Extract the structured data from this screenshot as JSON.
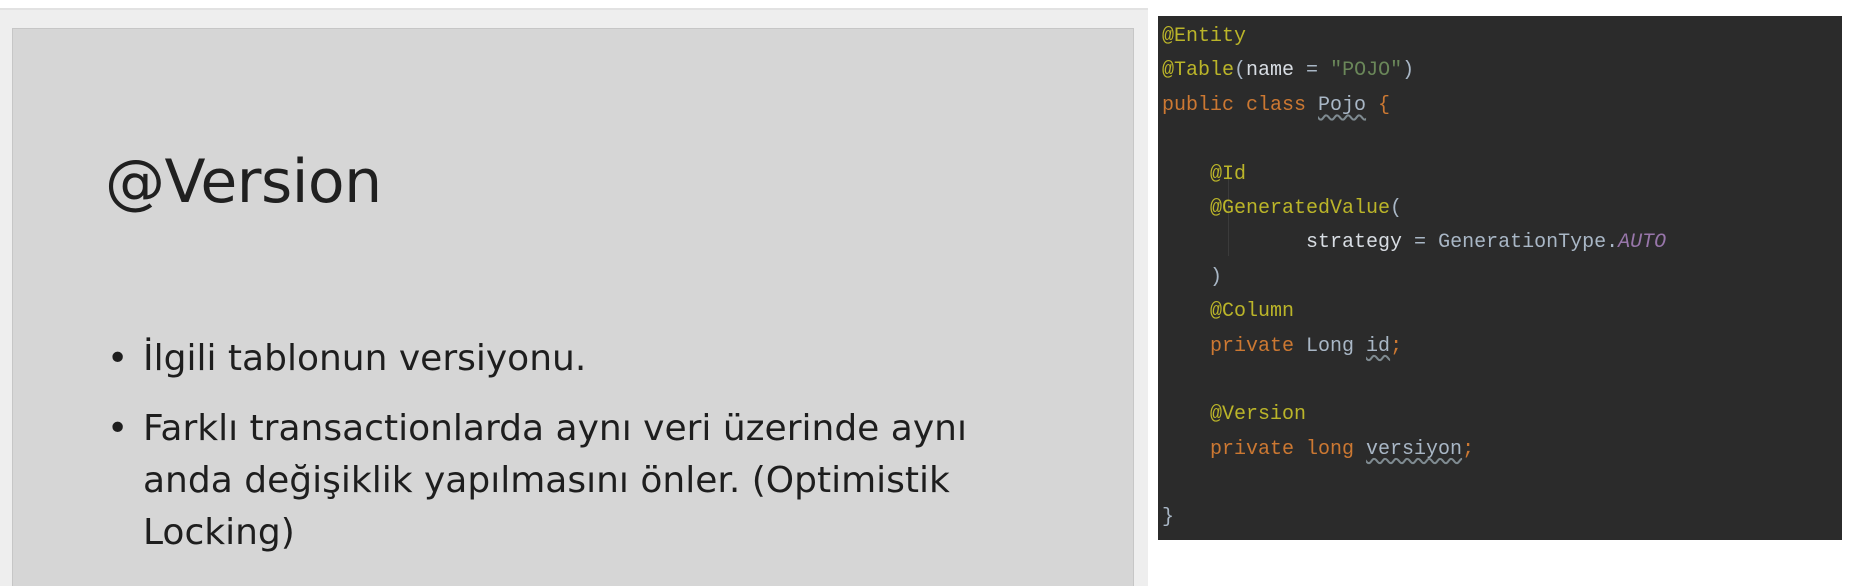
{
  "slide": {
    "title": "@Version",
    "bullets": [
      {
        "text": "İlgili tablonun versiyonu."
      },
      {
        "text": "Farklı transactionlarda aynı veri üzerinde aynı anda değişiklik yapılmasını önler. (Optimistik Locking)"
      }
    ],
    "bullet_symbol": "•"
  },
  "editor": {
    "colors": {
      "background": "#2b2b2b",
      "keyword": "#cc7832",
      "annotation": "#bbb529",
      "string": "#6a8759",
      "constant": "#9876aa",
      "text": "#a9b7c6"
    },
    "code": {
      "l1_ann": "@Entity",
      "l2_ann": "@Table",
      "l2_open": "(",
      "l2_param": "name",
      "l2_eq": " = ",
      "l2_str": "\"POJO\"",
      "l2_close": ")",
      "l3_kw": "public class ",
      "l3_name": "Pojo",
      "l3_brace": " {",
      "l5_ann": "@Id",
      "l6_ann": "@GeneratedValue",
      "l6_paren": "(",
      "l7_param": "strategy",
      "l7_eq": " = ",
      "l7_type": "GenerationType.",
      "l7_const": "AUTO",
      "l8_paren": ")",
      "l9_ann": "@Column",
      "l10_kw": "private ",
      "l10_type": "Long ",
      "l10_field": "id",
      "l10_semi": ";",
      "l12_ann": "@Version",
      "l13_kw": "private long ",
      "l13_field": "versiyon",
      "l13_semi": ";",
      "l15_brace": "}"
    }
  }
}
